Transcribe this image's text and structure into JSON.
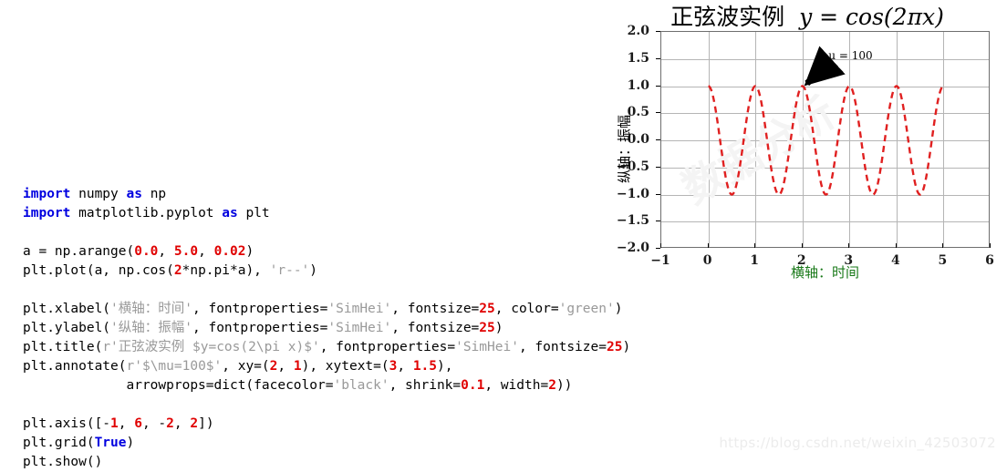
{
  "code": {
    "lines": [
      [
        {
          "t": "import",
          "c": "kw"
        },
        {
          "t": " numpy ",
          "c": "op"
        },
        {
          "t": "as",
          "c": "kw"
        },
        {
          "t": " np",
          "c": "op"
        }
      ],
      [
        {
          "t": "import",
          "c": "kw"
        },
        {
          "t": " matplotlib.pyplot ",
          "c": "op"
        },
        {
          "t": "as",
          "c": "kw"
        },
        {
          "t": " plt",
          "c": "op"
        }
      ],
      [],
      [
        {
          "t": "a = np.arange(",
          "c": "op"
        },
        {
          "t": "0.0",
          "c": "num"
        },
        {
          "t": ", ",
          "c": "op"
        },
        {
          "t": "5.0",
          "c": "num"
        },
        {
          "t": ", ",
          "c": "op"
        },
        {
          "t": "0.02",
          "c": "num"
        },
        {
          "t": ")",
          "c": "op"
        }
      ],
      [
        {
          "t": "plt.plot(a, np.cos(",
          "c": "op"
        },
        {
          "t": "2",
          "c": "num"
        },
        {
          "t": "*np.pi*a), ",
          "c": "op"
        },
        {
          "t": "'r--'",
          "c": "str"
        },
        {
          "t": ")",
          "c": "op"
        }
      ],
      [],
      [
        {
          "t": "plt.xlabel(",
          "c": "op"
        },
        {
          "t": "'横轴：时间'",
          "c": "str"
        },
        {
          "t": ", fontproperties=",
          "c": "op"
        },
        {
          "t": "'SimHei'",
          "c": "str"
        },
        {
          "t": ", fontsize=",
          "c": "op"
        },
        {
          "t": "25",
          "c": "num"
        },
        {
          "t": ", color=",
          "c": "op"
        },
        {
          "t": "'green'",
          "c": "str"
        },
        {
          "t": ")",
          "c": "op"
        }
      ],
      [
        {
          "t": "plt.ylabel(",
          "c": "op"
        },
        {
          "t": "'纵轴：振幅'",
          "c": "str"
        },
        {
          "t": ", fontproperties=",
          "c": "op"
        },
        {
          "t": "'SimHei'",
          "c": "str"
        },
        {
          "t": ", fontsize=",
          "c": "op"
        },
        {
          "t": "25",
          "c": "num"
        },
        {
          "t": ")",
          "c": "op"
        }
      ],
      [
        {
          "t": "plt.title(",
          "c": "op"
        },
        {
          "t": "r'正弦波实例 $y=cos(2\\pi x)$'",
          "c": "str"
        },
        {
          "t": ", fontproperties=",
          "c": "op"
        },
        {
          "t": "'SimHei'",
          "c": "str"
        },
        {
          "t": ", fontsize=",
          "c": "op"
        },
        {
          "t": "25",
          "c": "num"
        },
        {
          "t": ")",
          "c": "op"
        }
      ],
      [
        {
          "t": "plt.annotate(",
          "c": "op"
        },
        {
          "t": "r'$\\mu=100$'",
          "c": "str"
        },
        {
          "t": ", xy=(",
          "c": "op"
        },
        {
          "t": "2",
          "c": "num"
        },
        {
          "t": ", ",
          "c": "op"
        },
        {
          "t": "1",
          "c": "num"
        },
        {
          "t": "), xytext=(",
          "c": "op"
        },
        {
          "t": "3",
          "c": "num"
        },
        {
          "t": ", ",
          "c": "op"
        },
        {
          "t": "1.5",
          "c": "num"
        },
        {
          "t": "),",
          "c": "op"
        }
      ],
      [
        {
          "t": "             arrowprops=dict(facecolor=",
          "c": "op"
        },
        {
          "t": "'black'",
          "c": "str"
        },
        {
          "t": ", shrink=",
          "c": "op"
        },
        {
          "t": "0.1",
          "c": "num"
        },
        {
          "t": ", width=",
          "c": "op"
        },
        {
          "t": "2",
          "c": "num"
        },
        {
          "t": "))",
          "c": "op"
        }
      ],
      [],
      [
        {
          "t": "plt.axis([-",
          "c": "op"
        },
        {
          "t": "1",
          "c": "num"
        },
        {
          "t": ", ",
          "c": "op"
        },
        {
          "t": "6",
          "c": "num"
        },
        {
          "t": ", -",
          "c": "op"
        },
        {
          "t": "2",
          "c": "num"
        },
        {
          "t": ", ",
          "c": "op"
        },
        {
          "t": "2",
          "c": "num"
        },
        {
          "t": "])",
          "c": "op"
        }
      ],
      [
        {
          "t": "plt.grid(",
          "c": "op"
        },
        {
          "t": "True",
          "c": "kw"
        },
        {
          "t": ")",
          "c": "op"
        }
      ],
      [
        {
          "t": "plt.show()",
          "c": "op"
        }
      ]
    ],
    "colors": {
      "keyword": "#0000e0",
      "string": "#999999",
      "number": "#e00000",
      "plain": "#000000"
    }
  },
  "watermark": {
    "text": "https://blog.csdn.net/weixin_42503072",
    "figure_text": "数据分析"
  },
  "chart_data": {
    "type": "line",
    "title_cn": "正弦波实例",
    "title_math": "y = cos(2πx)",
    "title": "正弦波实例  y = cos(2πx)",
    "xlabel": "横轴：时间",
    "ylabel": "纵轴：振幅",
    "xlabel_color": "#1a7a1a",
    "series_color": "#e02020",
    "linestyle": "dashed",
    "grid": true,
    "legend": null,
    "xlim": [
      -1,
      6
    ],
    "ylim": [
      -2,
      2
    ],
    "xticks": [
      -1,
      0,
      1,
      2,
      3,
      4,
      5,
      6
    ],
    "xticklabels": [
      "−1",
      "0",
      "1",
      "2",
      "3",
      "4",
      "5",
      "6"
    ],
    "yticks": [
      -2.0,
      -1.5,
      -1.0,
      -0.5,
      0.0,
      0.5,
      1.0,
      1.5,
      2.0
    ],
    "yticklabels": [
      "−2.0",
      "−1.5",
      "−1.0",
      "−0.5",
      "0.0",
      "0.5",
      "1.0",
      "1.5",
      "2.0"
    ],
    "function": "y = cos(2*pi*x)",
    "x_domain_plotted": [
      0.0,
      5.0
    ],
    "x_step": 0.02,
    "annotation": {
      "text": "μ = 100",
      "xy": [
        2,
        1
      ],
      "xytext": [
        3,
        1.5
      ],
      "arrow_color": "#000000"
    }
  }
}
